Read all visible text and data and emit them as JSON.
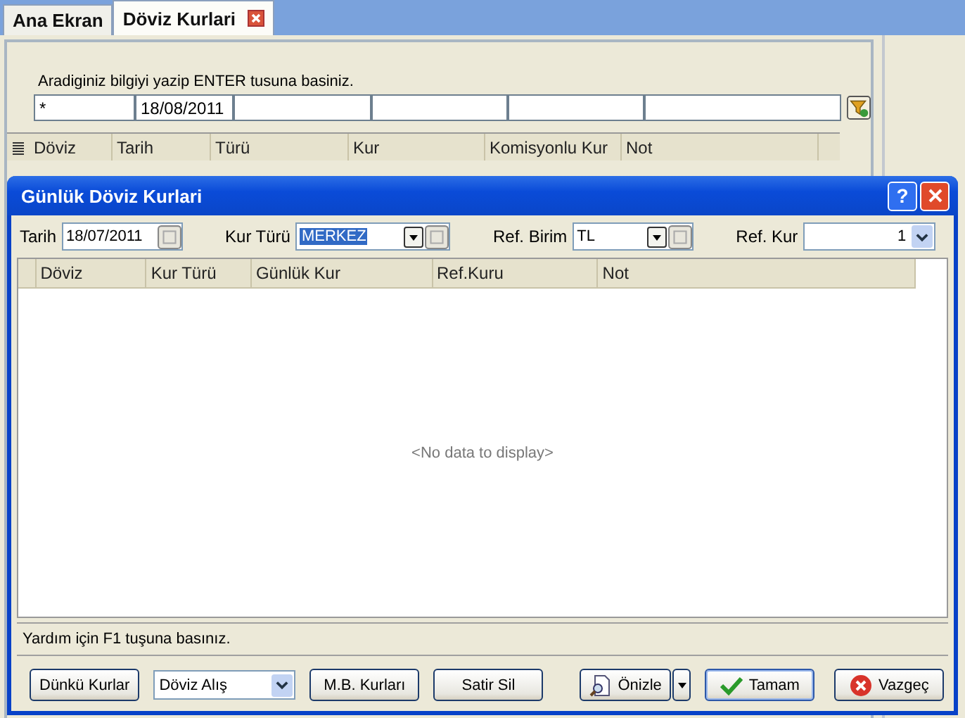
{
  "tabs": [
    {
      "label": "Ana Ekran",
      "selected": false,
      "closable": false
    },
    {
      "label": "Döviz Kurlari",
      "selected": true,
      "closable": true
    }
  ],
  "search": {
    "hint": "Aradiginiz bilgiyi yazip ENTER tusuna basiniz."
  },
  "grid": {
    "columns": [
      {
        "label": "Döviz",
        "filter": "*"
      },
      {
        "label": "Tarih",
        "filter": "18/08/2011"
      },
      {
        "label": "Türü"
      },
      {
        "label": "Kur"
      },
      {
        "label": "Komisyonlu Kur"
      },
      {
        "label": "Not"
      }
    ]
  },
  "dialog": {
    "title": "Günlük Döviz Kurlari",
    "help_label": "?",
    "tarih": {
      "label": "Tarih",
      "value": "18/07/2011"
    },
    "kur_turu": {
      "label": "Kur Türü",
      "value": "MERKEZ"
    },
    "ref_birim": {
      "label": "Ref. Birim",
      "value": "TL"
    },
    "ref_kur": {
      "label": "Ref. Kur",
      "value": "1"
    },
    "columns": [
      "Döviz",
      "Kur Türü",
      "Günlük Kur",
      "Ref.Kuru",
      "Not"
    ],
    "empty_text": "<No data to display>",
    "status": "Yardım için F1 tuşuna basınız.",
    "footer": [
      {
        "kind": "button",
        "label": "Dünkü Kurlar"
      },
      {
        "kind": "combo",
        "label": "Döviz Alış"
      },
      {
        "kind": "button",
        "label": "M.B. Kurları"
      },
      {
        "kind": "button",
        "label": "Satir Sil"
      },
      {
        "kind": "preview",
        "label": "Önizle"
      },
      {
        "kind": "ok",
        "label": "Tamam"
      },
      {
        "kind": "cancel",
        "label": "Vazgeç"
      }
    ]
  }
}
